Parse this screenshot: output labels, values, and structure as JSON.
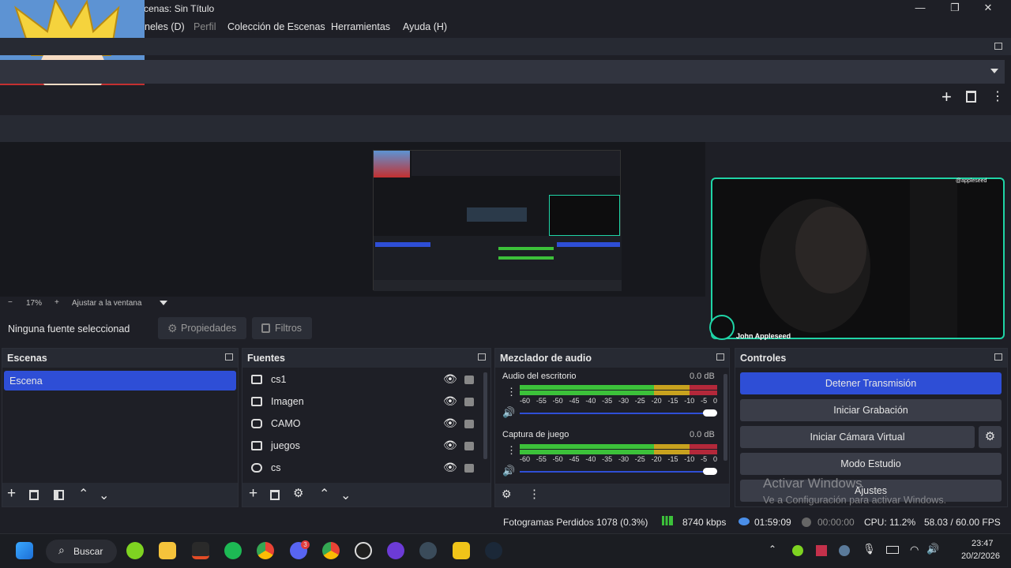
{
  "window": {
    "title": "cenas: Sin Título",
    "controls": [
      "—",
      "❐",
      "✕"
    ]
  },
  "menu": {
    "items": [
      "neles (D)",
      "Perfil",
      "Colección de Escenas",
      "Herramientas",
      "Ayuda (H)"
    ]
  },
  "preview": {
    "zoom": "17%",
    "zoom_minus": "−",
    "zoom_plus": "+",
    "fit_label": "Ajustar a la ventana"
  },
  "props_bar": {
    "no_source": "Ninguna fuente seleccionad",
    "properties": "Propiedades",
    "filters": "Filtros"
  },
  "webcam": {
    "handle": "@appleseed",
    "name": "John Appleseed"
  },
  "scenes": {
    "title": "Escenas",
    "items": [
      "Escena"
    ]
  },
  "sources": {
    "title": "Fuentes",
    "items": [
      {
        "label": "cs1",
        "icon": "window-icon"
      },
      {
        "label": "Imagen",
        "icon": "image-icon"
      },
      {
        "label": "CAMO",
        "icon": "camera-icon"
      },
      {
        "label": "juegos",
        "icon": "monitor-icon"
      },
      {
        "label": "cs",
        "icon": "gamepad-icon"
      }
    ]
  },
  "mixer": {
    "title": "Mezclador de audio",
    "ticks": [
      "-60",
      "-55",
      "-50",
      "-45",
      "-40",
      "-35",
      "-30",
      "-25",
      "-20",
      "-15",
      "-10",
      "-5",
      "0"
    ],
    "channels": [
      {
        "name": "Audio del escritorio",
        "db": "0.0 dB"
      },
      {
        "name": "Captura de juego",
        "db": "0.0 dB"
      }
    ]
  },
  "controls": {
    "title": "Controles",
    "stop_stream": "Detener Transmisión",
    "start_recording": "Iniciar Grabación",
    "start_virtual_cam": "Iniciar Cámara Virtual",
    "studio_mode": "Modo Estudio",
    "settings": "Ajustes"
  },
  "activation": {
    "title": "Activar Windows",
    "subtitle": "Ve a Configuración para activar Windows."
  },
  "status": {
    "dropped_frames": "Fotogramas Perdidos 1078 (0.3%)",
    "bitrate": "8740 kbps",
    "stream_time": "01:59:09",
    "rec_time": "00:00:00",
    "cpu": "CPU: 11.2%",
    "fps": "58.03 / 60.00 FPS"
  },
  "taskbar": {
    "search": "Buscar",
    "time": "23:47",
    "date": "20/2/2026",
    "discord_badge": "3",
    "colors": {
      "accent": "#2e4ed6",
      "webcam_border": "#1fd4a6",
      "meter_green": "#3cc13a",
      "meter_yellow": "#c8a21e",
      "meter_red": "#b3283a"
    }
  }
}
